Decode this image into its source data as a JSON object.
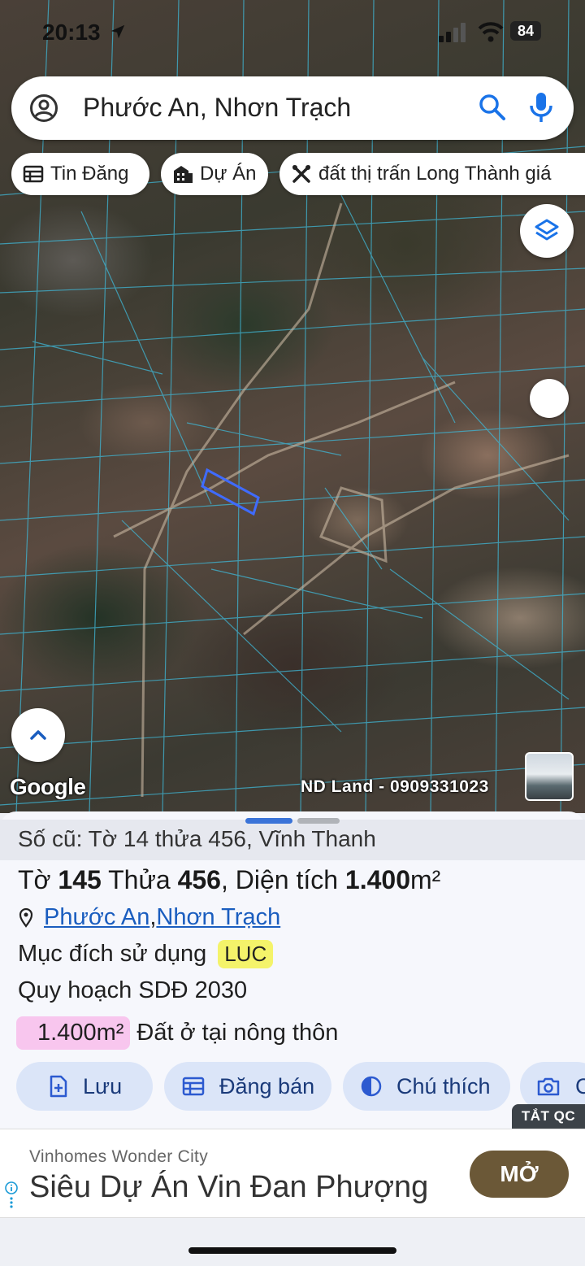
{
  "status_bar": {
    "time": "20:13",
    "battery": "84"
  },
  "search": {
    "text": "Phước An, Nhơn Trạch"
  },
  "chips": [
    {
      "label": "Tin Đăng",
      "icon": "table-icon"
    },
    {
      "label": "Dự Án",
      "icon": "building-icon"
    },
    {
      "label": "đất thị trấn Long Thành giá",
      "icon": "tools-icon"
    }
  ],
  "map": {
    "attribution": "Google",
    "watermark": "ND Land - 0909331023"
  },
  "sheet": {
    "old_ref": "Số cũ: Tờ 14 thửa 456, Vĩnh Thanh",
    "title": {
      "sheet_prefix": "Tờ",
      "sheet_no": "145",
      "parcel_prefix": "Thửa",
      "parcel_no": "456",
      "area_prefix": ", Diện tích",
      "area": "1.400",
      "unit": "m²"
    },
    "ward": "Phước An",
    "district": "Nhơn Trạch",
    "purpose_label": "Mục đích sử dụng",
    "purpose_code": "LUC",
    "planning": "Quy hoạch SDĐ 2030",
    "zone_area": "1.400m²",
    "zone_label": "Đất ở tại nông thôn",
    "actions": [
      "Lưu",
      "Đăng bán",
      "Chú thích",
      "C"
    ]
  },
  "ad": {
    "close_label": "TẮT QC",
    "source": "Vinhomes Wonder City",
    "headline": "Siêu Dự Án Vin Đan Phượng",
    "cta": "MỞ",
    "cta_color": "#6b5837"
  },
  "colors": {
    "accent": "#1a73e8",
    "link": "#1a5dbf",
    "parcel_outline": "#4a7cff",
    "badge_yellow": "#f4f36a",
    "badge_pink": "#f8c6ee"
  }
}
